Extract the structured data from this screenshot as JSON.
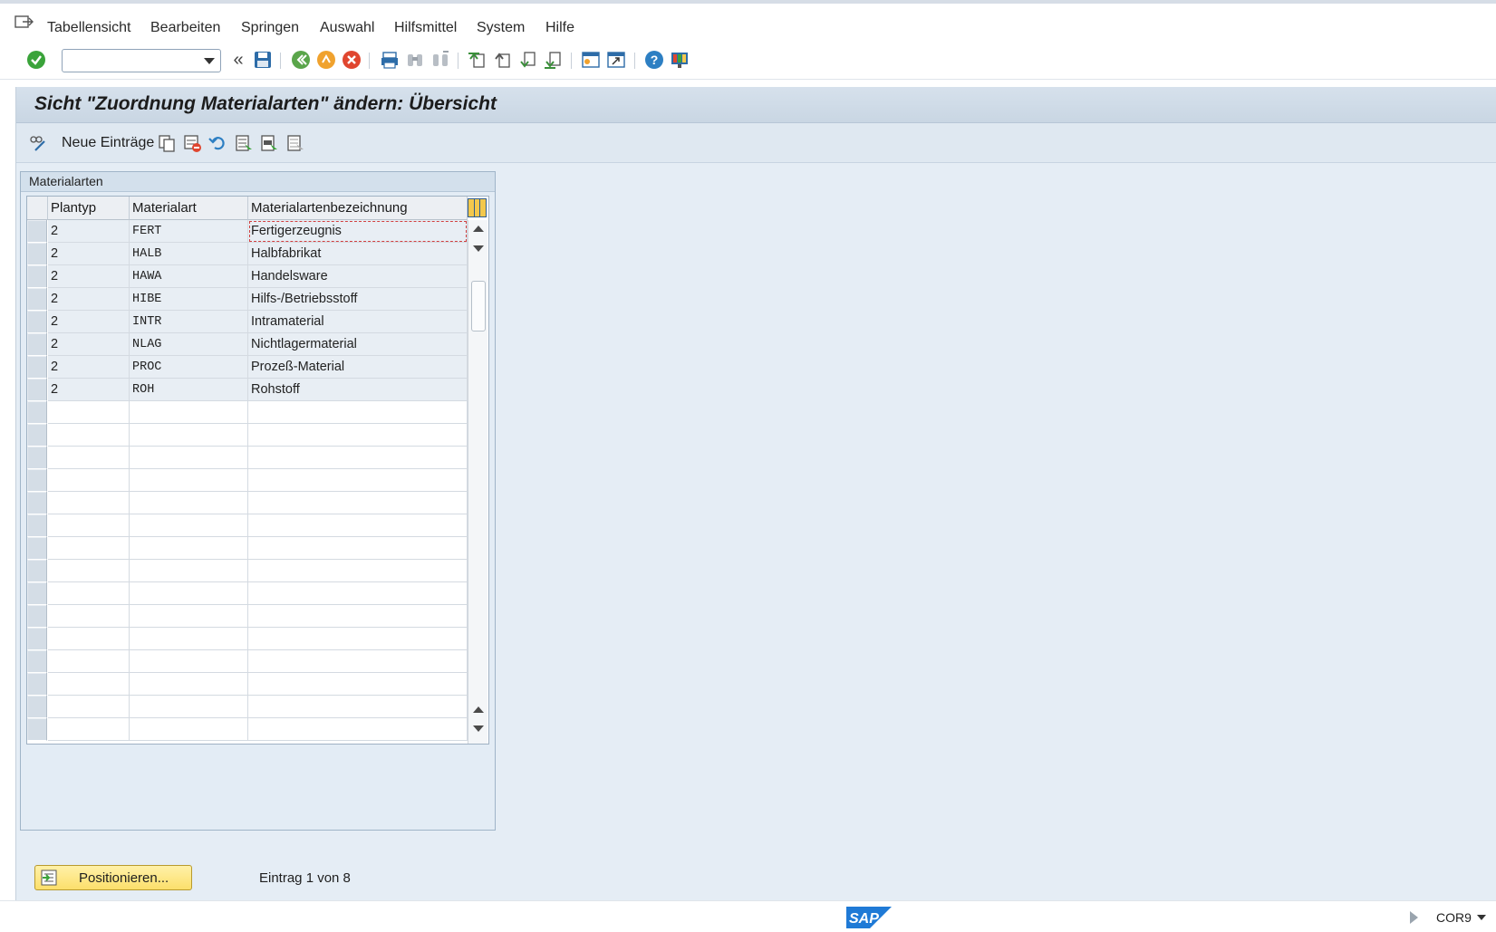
{
  "menu": {
    "items": [
      "Tabellensicht",
      "Bearbeiten",
      "Springen",
      "Auswahl",
      "Hilfsmittel",
      "System",
      "Hilfe"
    ]
  },
  "toolbar": {
    "command_field_value": "",
    "icons": [
      "enter-check-icon",
      "command-dropdown-icon",
      "collapse-icon",
      "save-icon",
      "back-icon",
      "exit-icon",
      "cancel-icon",
      "print-icon",
      "find-icon",
      "find-next-icon",
      "first-page-icon",
      "previous-page-icon",
      "next-page-icon",
      "last-page-icon",
      "create-session-icon",
      "create-shortcut-icon",
      "help-icon",
      "customize-layout-icon"
    ]
  },
  "screen": {
    "title": "Sicht \"Zuordnung Materialarten\" ändern: Übersicht"
  },
  "app_toolbar": {
    "new_entries_label": "Neue Einträge",
    "icons": [
      "edit-display-icon",
      "copy-icon",
      "delete-icon",
      "undo-icon",
      "select-all-icon",
      "select-block-icon",
      "deselect-all-icon"
    ]
  },
  "groupbox": {
    "title": "Materialarten"
  },
  "table": {
    "columns": [
      "Plantyp",
      "Materialart",
      "Materialartenbezeichnung"
    ],
    "rows": [
      [
        "2",
        "FERT",
        "Fertigerzeugnis"
      ],
      [
        "2",
        "HALB",
        "Halbfabrikat"
      ],
      [
        "2",
        "HAWA",
        "Handelsware"
      ],
      [
        "2",
        "HIBE",
        "Hilfs-/Betriebsstoff"
      ],
      [
        "2",
        "INTR",
        "Intramaterial"
      ],
      [
        "2",
        "NLAG",
        "Nichtlagermaterial"
      ],
      [
        "2",
        "PROC",
        "Prozeß-Material"
      ],
      [
        "2",
        "ROH",
        "Rohstoff"
      ]
    ],
    "empty_rows": 15
  },
  "footer": {
    "position_button": "Positionieren...",
    "entry_info": "Eintrag 1 von 8"
  },
  "statusbar": {
    "logo_text": "SAP",
    "system": "COR9"
  },
  "colors": {
    "accent_blue": "#2d6ca8",
    "title_bg": "#c9d6e3",
    "button_yellow": "#fcdf6b"
  }
}
